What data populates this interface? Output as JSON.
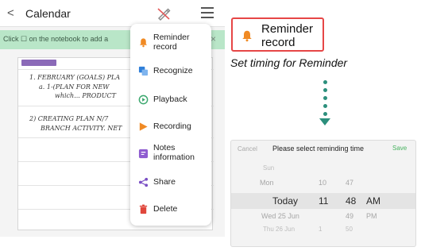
{
  "phone": {
    "header": {
      "back_icon": "chevron-left-icon",
      "title": "Calendar",
      "pen_icon": "pen-icon",
      "menu_icon": "hamburger-icon"
    },
    "hint_banner": {
      "text": "Click ☐ on the notebook to add a",
      "close": "×"
    },
    "note": {
      "tag_color": "#8b6ab8",
      "lines": [
        "1. FEBRUARY (GOALS) PLA",
        "a. 1-(PLAN FOR NEW",
        "which... PRODUCT",
        "2) CREATING PLAN N/7",
        "BRANCH ACTIVITY. NET"
      ]
    },
    "menu": {
      "items": [
        {
          "label": "Reminder record",
          "icon": "bell-icon",
          "color": "#f08a24"
        },
        {
          "label": "Recognize",
          "icon": "recognize-icon",
          "color": "#2f7fd9"
        },
        {
          "label": "Playback",
          "icon": "playback-icon",
          "color": "#3aa76d"
        },
        {
          "label": "Recording",
          "icon": "recording-icon",
          "color": "#f08a24"
        },
        {
          "label": "Notes information",
          "icon": "notes-info-icon",
          "color": "#8e5bd0"
        },
        {
          "label": "Share",
          "icon": "share-icon",
          "color": "#7a4fc4"
        },
        {
          "label": "Delete",
          "icon": "trash-icon",
          "color": "#e0463b"
        }
      ]
    }
  },
  "annotation": {
    "callout_label": "Reminder record",
    "callout_icon": "bell-icon",
    "caption": "Set timing for Reminder",
    "accent_color": "#2c8f7c",
    "border_color": "#e64646"
  },
  "picker": {
    "cancel": "Cancel",
    "title": "Please select reminding time",
    "save": "Save",
    "rows": [
      {
        "day": "Sun",
        "hour": "",
        "minute": "",
        "ampm": ""
      },
      {
        "day": "Mon",
        "hour": "10",
        "minute": "47",
        "ampm": ""
      },
      {
        "day": "Today",
        "hour": "11",
        "minute": "48",
        "ampm": "AM"
      },
      {
        "day": "Wed 25 Jun",
        "hour": "",
        "minute": "49",
        "ampm": "PM"
      },
      {
        "day": "Thu 26 Jun",
        "hour": "1",
        "minute": "50",
        "ampm": ""
      }
    ]
  }
}
